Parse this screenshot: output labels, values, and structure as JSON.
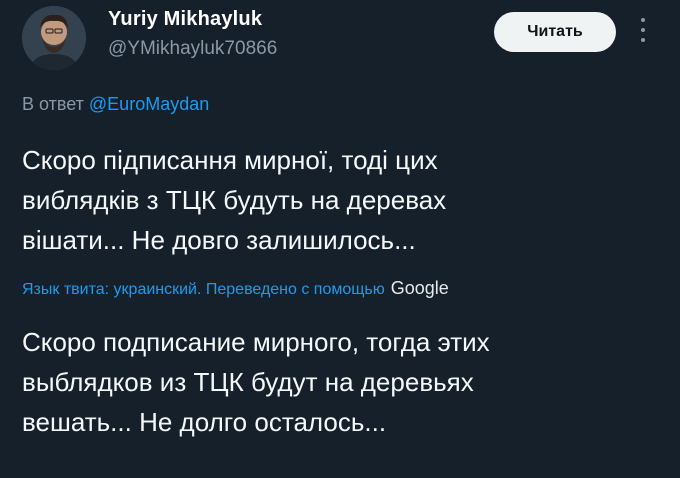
{
  "header": {
    "display_name": "Yuriy Mikhayluk",
    "handle": "@YMikhayluk70866",
    "follow_label": "Читать",
    "more_icon": "more-vertical-icon"
  },
  "reply": {
    "prefix": "В ответ",
    "mention": "@EuroMaydan"
  },
  "tweet": {
    "text": "Скоро підписання мирної, тоді цих\nвиблядків з ТЦК будуть на деревах\nвішати... Не довго залишилось..."
  },
  "translation": {
    "label": "Язык твита: украинский. Переведено с помощью",
    "provider": "Google",
    "text": "Скоро подписание мирного, тогда этих\nвыблядков из ТЦК будут на деревьях\nвешать... Не долго осталось..."
  },
  "colors": {
    "background": "#15202b",
    "accent": "#1d9bf0",
    "secondary_text": "#8b98a5",
    "primary_text": "#f5f8fa"
  }
}
